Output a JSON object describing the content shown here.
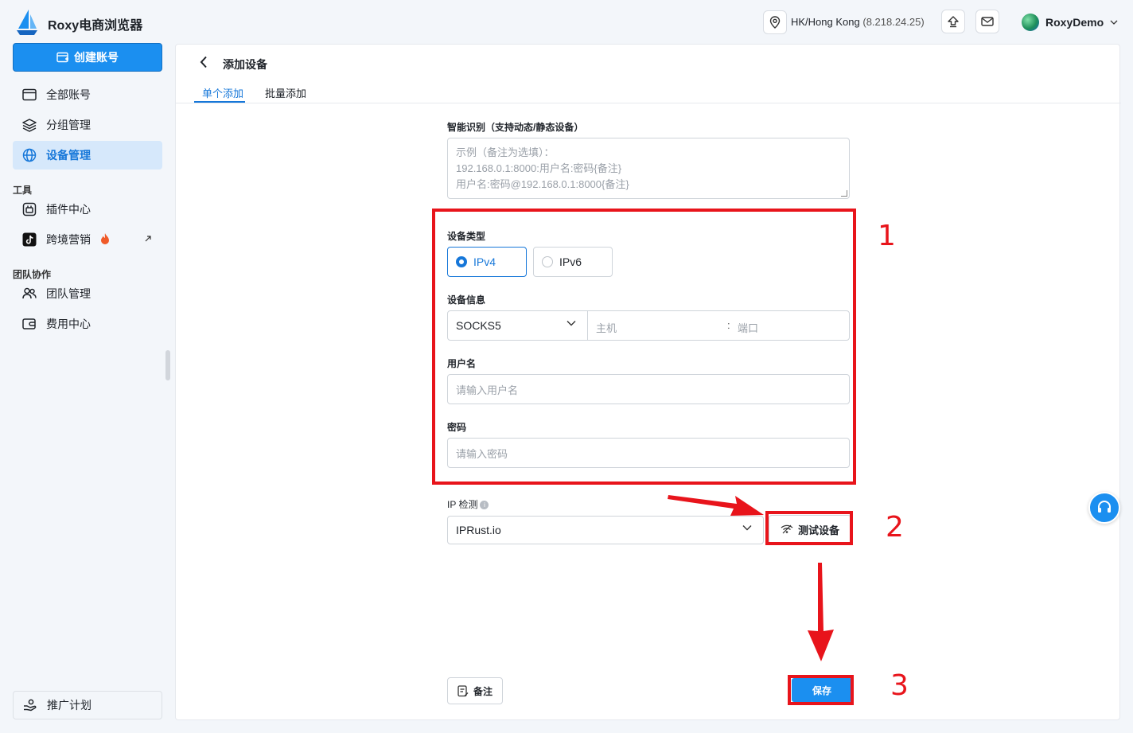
{
  "app": {
    "title": "Roxy电商浏览器"
  },
  "header": {
    "location_label": "HK/Hong Kong",
    "location_ip": "(8.218.24.25)",
    "user_name": "RoxyDemo"
  },
  "sidebar": {
    "create_label": "创建账号",
    "items": [
      {
        "label": "全部账号",
        "icon": "window-icon"
      },
      {
        "label": "分组管理",
        "icon": "layers-icon"
      },
      {
        "label": "设备管理",
        "icon": "globe-icon",
        "active": true
      }
    ],
    "tools_section": "工具",
    "tools": [
      {
        "label": "插件中心",
        "icon": "plugin-icon"
      },
      {
        "label": "跨境营销",
        "icon": "tiktok-icon",
        "badge": "fire-icon"
      }
    ],
    "team_section": "团队协作",
    "team": [
      {
        "label": "团队管理",
        "icon": "users-icon"
      },
      {
        "label": "费用中心",
        "icon": "wallet-icon"
      }
    ],
    "promo_label": "推广计划"
  },
  "page": {
    "title": "添加设备",
    "tabs": [
      {
        "label": "单个添加",
        "active": true
      },
      {
        "label": "批量添加"
      }
    ]
  },
  "form": {
    "smart_label": "智能识别（支持动态/静态设备）",
    "smart_placeholder_lines": [
      "示例（备注为选填）：",
      "192.168.0.1:8000:用户名:密码{备注}",
      "用户名:密码@192.168.0.1:8000{备注}"
    ],
    "type_label": "设备类型",
    "type_options": [
      "IPv4",
      "IPv6"
    ],
    "type_selected": "IPv4",
    "info_label": "设备信息",
    "protocol_value": "SOCKS5",
    "host_placeholder": "主机",
    "port_separator": ":",
    "port_placeholder": "端口",
    "username_label": "用户名",
    "username_placeholder": "请输入用户名",
    "password_label": "密码",
    "password_placeholder": "请输入密码",
    "ipcheck_label": "IP 检测",
    "ipcheck_value": "IPRust.io",
    "test_label": "测试设备",
    "note_label": "备注",
    "save_label": "保存"
  },
  "annotations": {
    "highlight_color": "#e8141b",
    "steps": [
      "1",
      "2",
      "3"
    ]
  },
  "colors": {
    "accent": "#1b8ff0",
    "active_nav_bg": "#d6e8fb"
  }
}
